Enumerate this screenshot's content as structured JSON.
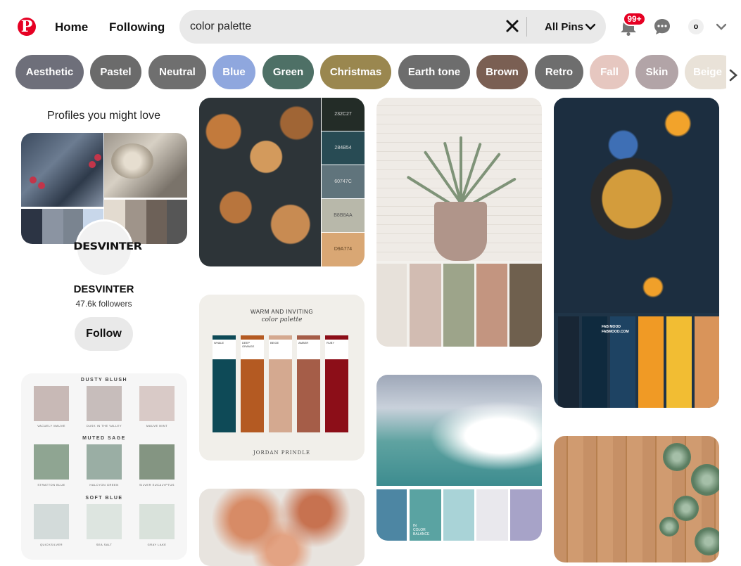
{
  "header": {
    "logo_glyph": "P",
    "nav": {
      "home": "Home",
      "following": "Following"
    },
    "search": {
      "value": "color palette",
      "filter": "All Pins"
    },
    "notifications_badge": "99+",
    "avatar_initial": "o"
  },
  "chips": [
    {
      "label": "Aesthetic",
      "color": "#6e6f7a"
    },
    {
      "label": "Pastel",
      "color": "#6b6b6b"
    },
    {
      "label": "Neutral",
      "color": "#6f6f6f"
    },
    {
      "label": "Blue",
      "color": "#8fa7de"
    },
    {
      "label": "Green",
      "color": "#4e7066"
    },
    {
      "label": "Christmas",
      "color": "#9a874f"
    },
    {
      "label": "Earth tone",
      "color": "#6d6d6d"
    },
    {
      "label": "Brown",
      "color": "#7a5f53"
    },
    {
      "label": "Retro",
      "color": "#6e6e6e"
    },
    {
      "label": "Fall",
      "color": "#e6c7c0"
    },
    {
      "label": "Skin",
      "color": "#b2a4a7"
    },
    {
      "label": "Beige",
      "color": "#e9e2d8"
    }
  ],
  "profiles": {
    "title": "Profiles you might love",
    "name": "DESVINTER",
    "avatar_text": "DESVINTER",
    "followers": "47.6k followers",
    "follow_label": "Follow"
  },
  "pins": {
    "wood": {
      "codes": [
        "232C27",
        "284B54",
        "60747C",
        "B8B8AA",
        "D9A774"
      ]
    },
    "warm": {
      "title": "WARM AND INVITING",
      "subtitle": "color palette",
      "author": "JORDAN PRINDLE",
      "columns": [
        "WHALE",
        "DEEP ORANGE",
        "BEIGE",
        "AMBER",
        "RUBY"
      ]
    },
    "sage": {
      "headers": [
        "DUSTY BLUSH",
        "MUTED SAGE",
        "SOFT BLUE"
      ],
      "labels": [
        "VACUELY MAUVE",
        "DUSK IN THE VALLEY",
        "MAUVE MINT",
        "STRATTON BLUE",
        "HALCYON GREEN",
        "SILVER EUCALYPTUS",
        "QUICKSILVER",
        "SEA SALT",
        "GRAY LAKE"
      ]
    },
    "wave_label": "IN\nCOLOR\nBALANCE",
    "berry_label": "FAB MOOD\nFABMOOD.COM"
  }
}
